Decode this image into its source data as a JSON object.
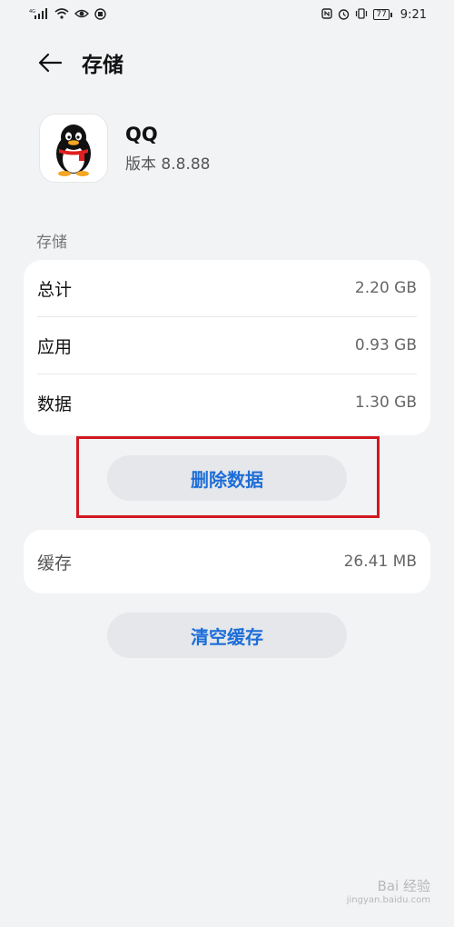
{
  "status_bar": {
    "left_icons": [
      "signal-4g-icon",
      "wifi-icon",
      "eye-icon",
      "app-notification-icon"
    ],
    "right_icons": [
      "nfc-icon",
      "alarm-icon",
      "vibrate-icon"
    ],
    "battery": "77",
    "time": "9:21"
  },
  "header": {
    "title": "存储"
  },
  "app": {
    "name": "QQ",
    "version": "版本 8.8.88"
  },
  "storage": {
    "section_label": "存储",
    "rows": [
      {
        "label": "总计",
        "value": "2.20 GB"
      },
      {
        "label": "应用",
        "value": "0.93 GB"
      },
      {
        "label": "数据",
        "value": "1.30 GB"
      }
    ]
  },
  "delete_button": {
    "label": "删除数据"
  },
  "cache": {
    "label": "缓存",
    "value": "26.41 MB"
  },
  "clear_cache_button": {
    "label": "清空缓存"
  },
  "watermark": {
    "text": "Bai 经验",
    "subtext": "jingyan.baidu.com"
  },
  "colors": {
    "accent": "#1d6ed8",
    "highlight": "#d2171f",
    "background": "#f1f3f5"
  }
}
